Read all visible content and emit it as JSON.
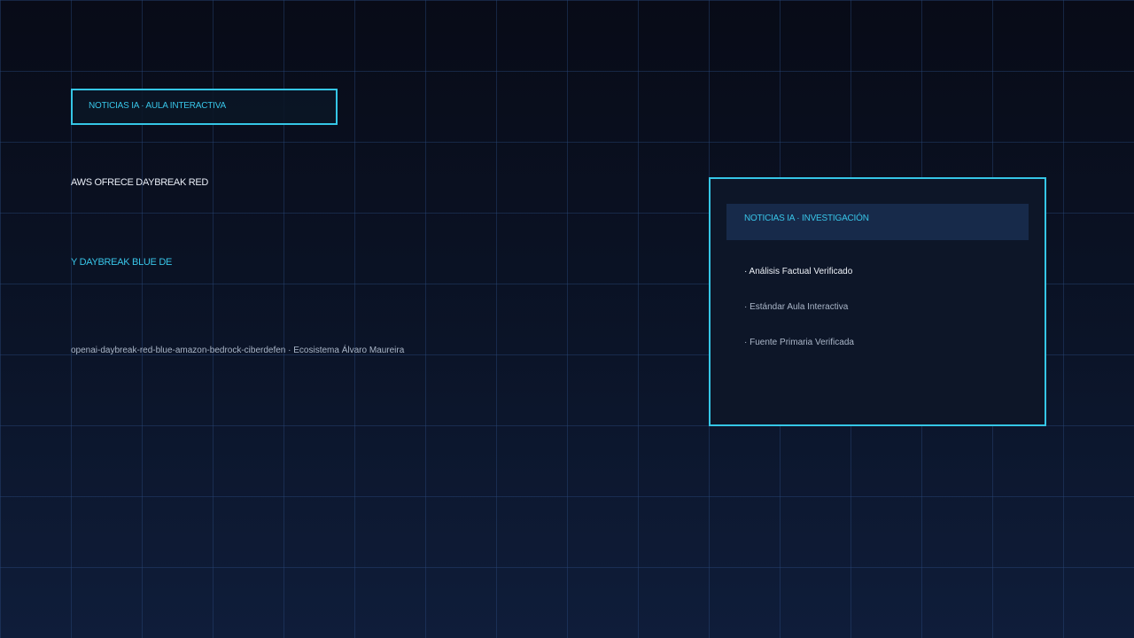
{
  "header": {
    "badge_label": "NOTICIAS IA · AULA INTERACTIVA"
  },
  "main": {
    "headline_line1": "AWS OFRECE DAYBREAK RED",
    "headline_line2": "Y DAYBREAK BLUE DE",
    "slug": "openai-daybreak-red-blue-amazon-bedrock-ciberdefen · Ecosistema Álvaro Maureira"
  },
  "panel": {
    "title": "NOTICIAS IA · INVESTIGACIÓN",
    "items": [
      "· Análisis Factual Verificado",
      "· Estándar Aula Interactiva",
      "· Fuente Primaria Verificada"
    ]
  },
  "colors": {
    "accent": "#35c6e6",
    "background_top": "#080b17",
    "background_bottom": "#0f1d3a",
    "panel_header": "#172a4a"
  }
}
